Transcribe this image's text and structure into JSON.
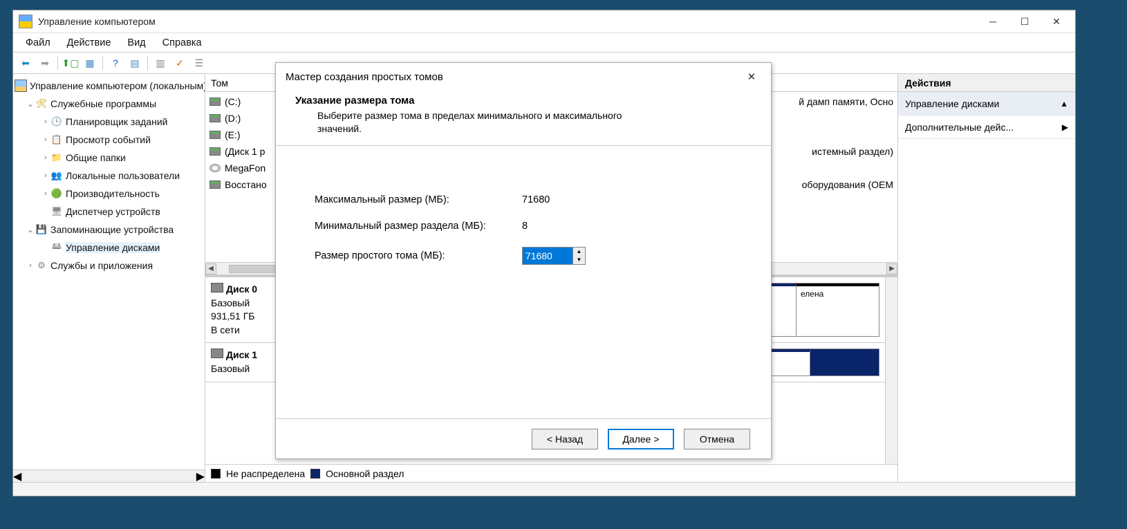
{
  "window": {
    "title": "Управление компьютером"
  },
  "menu": {
    "file": "Файл",
    "action": "Действие",
    "view": "Вид",
    "help": "Справка"
  },
  "tree": {
    "root": "Управление компьютером (локальным)",
    "utils": "Служебные программы",
    "scheduler": "Планировщик заданий",
    "events": "Просмотр событий",
    "shared": "Общие папки",
    "localusers": "Локальные пользователи",
    "perf": "Производительность",
    "devmgr": "Диспетчер устройств",
    "storage": "Запоминающие устройства",
    "diskmgmt": "Управление дисками",
    "services": "Службы и приложения"
  },
  "volumes": {
    "header": "Том",
    "c": "(C:)",
    "d": "(D:)",
    "e": "(E:)",
    "disk1p": "(Диск 1 р",
    "megafon": "MegaFon",
    "recover": "Восстано",
    "right1": "й дамп памяти, Осно",
    "right2": "истемный раздел)",
    "right3": "оборудования (OEM"
  },
  "disks": {
    "d0": {
      "name": "Диск 0",
      "type": "Базовый",
      "size": "931,51 ГБ",
      "status": "В сети",
      "part_tag": "елена"
    },
    "d1": {
      "name": "Диск 1",
      "type": "Базовый"
    }
  },
  "legend": {
    "unalloc": "Не распределена",
    "primary": "Основной раздел"
  },
  "actions": {
    "header": "Действия",
    "row1": "Управление дисками",
    "row2": "Дополнительные дейс..."
  },
  "wizard": {
    "title": "Мастер создания простых томов",
    "heading": "Указание размера тома",
    "sub": "Выберите размер тома в пределах минимального и максимального значений.",
    "max_label": "Максимальный размер (МБ):",
    "max_val": "71680",
    "min_label": "Минимальный размер раздела (МБ):",
    "min_val": "8",
    "size_label": "Размер простого тома (МБ):",
    "size_val": "71680",
    "back": "< Назад",
    "next": "Далее >",
    "cancel": "Отмена"
  }
}
